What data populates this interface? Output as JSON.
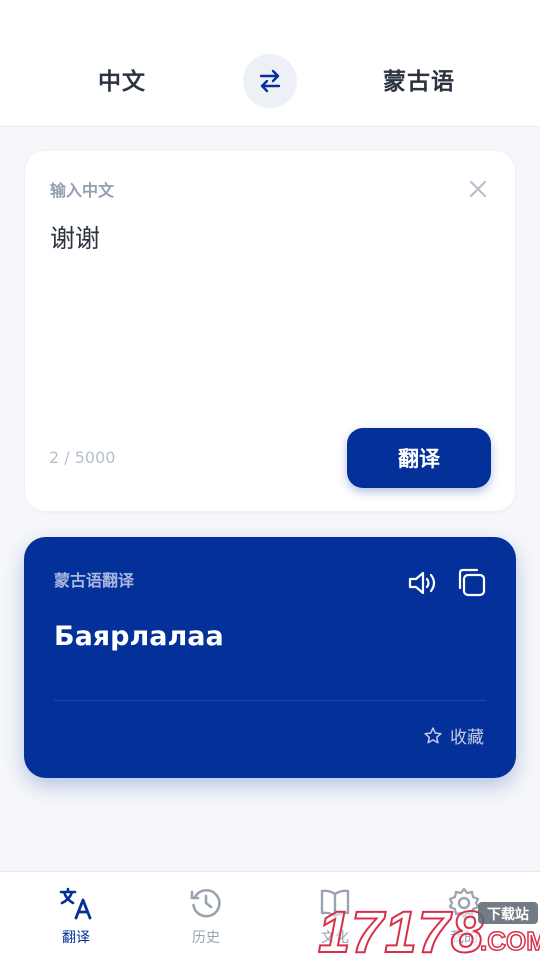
{
  "header": {
    "source_lang": "中文",
    "target_lang": "蒙古语",
    "swap_icon": "swap-arrows-icon"
  },
  "input_card": {
    "label": "输入中文",
    "text": "谢谢",
    "counter": "2 / 5000",
    "translate_label": "翻译",
    "clear_icon": "close-icon"
  },
  "result_card": {
    "label": "蒙古语翻译",
    "text": "Баярлалаа",
    "favorite_label": "收藏",
    "icons": [
      "speaker-icon",
      "copy-icon",
      "star-icon"
    ]
  },
  "bottom_nav": {
    "items": [
      {
        "label": "翻译",
        "icon": "translate-icon",
        "active": true
      },
      {
        "label": "历史",
        "icon": "history-icon",
        "active": false
      },
      {
        "label": "文化",
        "icon": "book-icon",
        "active": false
      },
      {
        "label": "我的",
        "icon": "gear-icon",
        "active": false
      }
    ]
  },
  "watermark": {
    "number": "17178",
    "badge": "下载站",
    "suffix": ".COM"
  },
  "colors": {
    "primary": "#04309a",
    "background": "#f5f7fa",
    "muted": "#94a0b2"
  }
}
